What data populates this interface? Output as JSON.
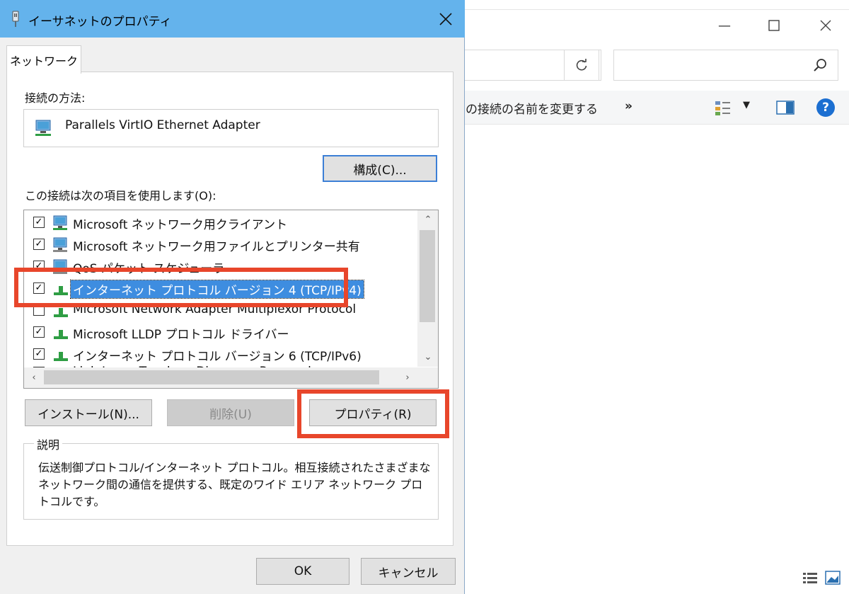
{
  "background_window": {
    "command_text": "の接続の名前を変更する",
    "more_label": "»",
    "help_label": "?"
  },
  "dialog": {
    "title": "イーサネットのプロパティ",
    "tab_label": "ネットワーク",
    "connect_using_label": "接続の方法:",
    "adapter_name": "Parallels VirtIO Ethernet Adapter",
    "configure_button": "構成(C)...",
    "items_label": "この接続は次の項目を使用します(O):",
    "items": [
      {
        "label": "Microsoft ネットワーク用クライアント",
        "checked": true,
        "icon": "network-client-icon"
      },
      {
        "label": "Microsoft ネットワーク用ファイルとプリンター共有",
        "checked": true,
        "icon": "network-service-icon"
      },
      {
        "label": "QoS パケット スケジューラ",
        "checked": true,
        "icon": "network-service-icon"
      },
      {
        "label": "インターネット プロトコル バージョン 4 (TCP/IPv4)",
        "checked": true,
        "icon": "protocol-icon",
        "selected": true
      },
      {
        "label": "Microsoft Network Adapter Multiplexor Protocol",
        "checked": false,
        "icon": "protocol-icon"
      },
      {
        "label": "Microsoft LLDP プロトコル ドライバー",
        "checked": true,
        "icon": "protocol-icon"
      },
      {
        "label": "インターネット プロトコル バージョン 6 (TCP/IPv6)",
        "checked": true,
        "icon": "protocol-icon"
      },
      {
        "label": "Link-Layer Topology Discovery Responder",
        "checked": true,
        "icon": "protocol-icon"
      }
    ],
    "install_button": "インストール(N)...",
    "uninstall_button": "削除(U)",
    "properties_button": "プロパティ(R)",
    "description_legend": "説明",
    "description_text": "伝送制御プロトコル/インターネット プロトコル。相互接続されたさまざまなネットワーク間の通信を提供する、既定のワイド エリア ネットワーク プロトコルです。",
    "ok_button": "OK",
    "cancel_button": "キャンセル"
  },
  "colors": {
    "titlebar": "#64b3ec",
    "selection": "#3e8de0",
    "highlight_box": "#e8462b"
  }
}
